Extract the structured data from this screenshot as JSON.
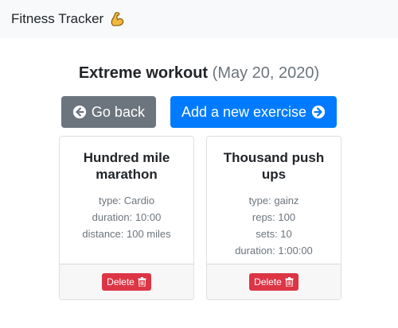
{
  "navbar": {
    "brand": "Fitness Tracker",
    "brand_icon": "flexed-biceps-icon"
  },
  "workout": {
    "name": "Extreme workout",
    "date": "(May 20, 2020)"
  },
  "actions": {
    "back_label": "Go back",
    "back_icon": "arrow-circle-left-icon",
    "add_label": "Add a new exercise",
    "add_icon": "arrow-circle-right-icon"
  },
  "colors": {
    "primary": "#007bff",
    "secondary": "#6c757d",
    "danger": "#dc3545",
    "navbar_bg": "#f8f9fa"
  },
  "exercises": [
    {
      "title": "Hundred mile marathon",
      "lines": [
        "type: Cardio",
        "duration: 10:00",
        "distance: 100 miles"
      ],
      "delete_label": "Delete"
    },
    {
      "title": "Thousand push ups",
      "lines": [
        "type: gainz",
        "reps: 100",
        "sets: 10",
        "duration: 1:00:00"
      ],
      "delete_label": "Delete"
    }
  ]
}
